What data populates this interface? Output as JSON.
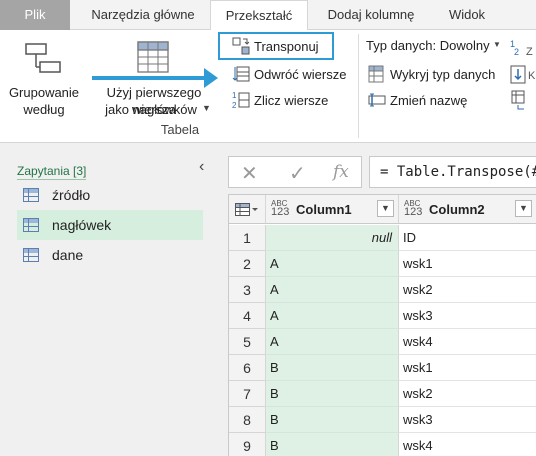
{
  "tabs": [
    "Plik",
    "Narzędzia główne",
    "Przekształć",
    "Dodaj kolumnę",
    "Widok"
  ],
  "ribbon": {
    "group_by_label": "Grupowanie według",
    "use_first_row_label_1": "Użyj pierwszego wiersza",
    "use_first_row_label_2": "jako nagłówków",
    "transpose_label": "Transponuj",
    "reverse_rows_label": "Odwróć wiersze",
    "count_rows_label": "Zlicz wiersze",
    "data_type_label": "Typ danych: Dowolny",
    "detect_type_label": "Wykryj typ danych",
    "rename_label": "Zmień nazwę",
    "group_label": "Tabela",
    "accent_color": "#2e9bd6"
  },
  "queries": {
    "title": "Zapytania [3]",
    "items": [
      "źródło",
      "nagłówek",
      "dane"
    ],
    "selected_index": 1
  },
  "formula": {
    "cancel_icon": "✕",
    "confirm_icon": "✓",
    "fx_icon": "fx",
    "text": "= Table.Transpose(#"
  },
  "table": {
    "columns": [
      {
        "type_top": "ABC",
        "type_bottom": "123",
        "name": "Column1"
      },
      {
        "type_top": "ABC",
        "type_bottom": "123",
        "name": "Column2"
      }
    ],
    "rows": [
      {
        "n": "1",
        "c1": "null",
        "c2": "ID"
      },
      {
        "n": "2",
        "c1": "A",
        "c2": "wsk1"
      },
      {
        "n": "3",
        "c1": "A",
        "c2": "wsk2"
      },
      {
        "n": "4",
        "c1": "A",
        "c2": "wsk3"
      },
      {
        "n": "5",
        "c1": "A",
        "c2": "wsk4"
      },
      {
        "n": "6",
        "c1": "B",
        "c2": "wsk1"
      },
      {
        "n": "7",
        "c1": "B",
        "c2": "wsk2"
      },
      {
        "n": "8",
        "c1": "B",
        "c2": "wsk3"
      },
      {
        "n": "9",
        "c1": "B",
        "c2": "wsk4"
      }
    ]
  }
}
